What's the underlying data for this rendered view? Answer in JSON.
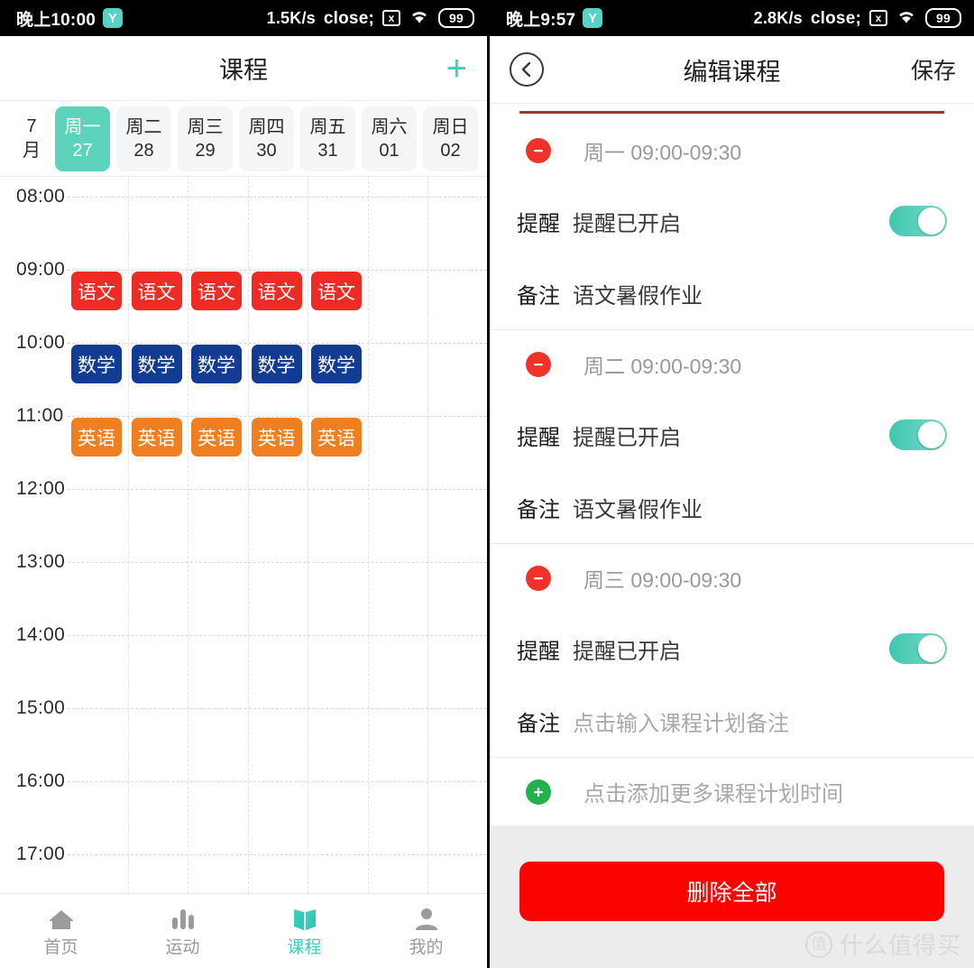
{
  "left": {
    "statusbar": {
      "time": "晚上10:00",
      "app_badge": "Y",
      "net_speed": "1.5K/s",
      "bluetooth_icon": "bluetooth-icon",
      "nosim_icon": "no-sim-icon",
      "nosim_glyph": "x",
      "wifi_icon": "wifi-icon",
      "battery": "99"
    },
    "header": {
      "title": "课程",
      "add_icon": "plus-icon",
      "add_label": "+"
    },
    "daystrip": {
      "month_top": "7",
      "month_bottom": "月",
      "days": [
        {
          "weekday": "周一",
          "date": "27",
          "selected": true
        },
        {
          "weekday": "周二",
          "date": "28",
          "selected": false
        },
        {
          "weekday": "周三",
          "date": "29",
          "selected": false
        },
        {
          "weekday": "周四",
          "date": "30",
          "selected": false
        },
        {
          "weekday": "周五",
          "date": "31",
          "selected": false
        },
        {
          "weekday": "周六",
          "date": "01",
          "selected": false
        },
        {
          "weekday": "周日",
          "date": "02",
          "selected": false
        }
      ]
    },
    "schedule": {
      "hours": [
        "08:00",
        "09:00",
        "10:00",
        "11:00",
        "12:00",
        "13:00",
        "14:00",
        "15:00",
        "16:00",
        "17:00"
      ],
      "courses": [
        {
          "label": "语文",
          "hour": "09:00",
          "color": "#ef2b26",
          "days": [
            0,
            1,
            2,
            3,
            4
          ]
        },
        {
          "label": "数学",
          "hour": "10:00",
          "color": "#123c94",
          "days": [
            0,
            1,
            2,
            3,
            4
          ]
        },
        {
          "label": "英语",
          "hour": "11:00",
          "color": "#f07f22",
          "days": [
            0,
            1,
            2,
            3,
            4
          ]
        }
      ]
    },
    "tabbar": [
      {
        "label": "首页",
        "icon": "home-icon",
        "active": false
      },
      {
        "label": "运动",
        "icon": "bar-chart-icon",
        "active": false
      },
      {
        "label": "课程",
        "icon": "book-icon",
        "active": true
      },
      {
        "label": "我的",
        "icon": "person-icon",
        "active": false
      }
    ]
  },
  "right": {
    "statusbar": {
      "time": "晚上9:57",
      "app_badge": "Y",
      "net_speed": "2.8K/s",
      "bluetooth_icon": "bluetooth-icon",
      "nosim_icon": "no-sim-icon",
      "nosim_glyph": "x",
      "wifi_icon": "wifi-icon",
      "battery": "99"
    },
    "header": {
      "title": "编辑课程",
      "back_icon": "chevron-left-icon",
      "save_label": "保存"
    },
    "plans": [
      {
        "remove_icon": "minus-circle-icon",
        "time": "周一 09:00-09:30",
        "remind_label": "提醒",
        "remind_value": "提醒已开启",
        "remind_on": true,
        "note_label": "备注",
        "note_value": "语文暑假作业",
        "note_is_placeholder": false
      },
      {
        "remove_icon": "minus-circle-icon",
        "time": "周二 09:00-09:30",
        "remind_label": "提醒",
        "remind_value": "提醒已开启",
        "remind_on": true,
        "note_label": "备注",
        "note_value": "语文暑假作业",
        "note_is_placeholder": false
      },
      {
        "remove_icon": "minus-circle-icon",
        "time": "周三 09:00-09:30",
        "remind_label": "提醒",
        "remind_value": "提醒已开启",
        "remind_on": true,
        "note_label": "备注",
        "note_value": "点击输入课程计划备注",
        "note_is_placeholder": true
      }
    ],
    "add_row": {
      "icon": "plus-circle-icon",
      "label": "点击添加更多课程计划时间"
    },
    "delete_button": {
      "label": "删除全部",
      "color": "#fa0400"
    },
    "watermark": {
      "mark": "值",
      "text": "什么值得买"
    }
  },
  "colors": {
    "accent_teal": "#3fcfbe",
    "selected_day": "#5ed3bb",
    "chinese": "#ef2b26",
    "math": "#123c94",
    "english": "#f07f22",
    "danger": "#fa0400"
  }
}
